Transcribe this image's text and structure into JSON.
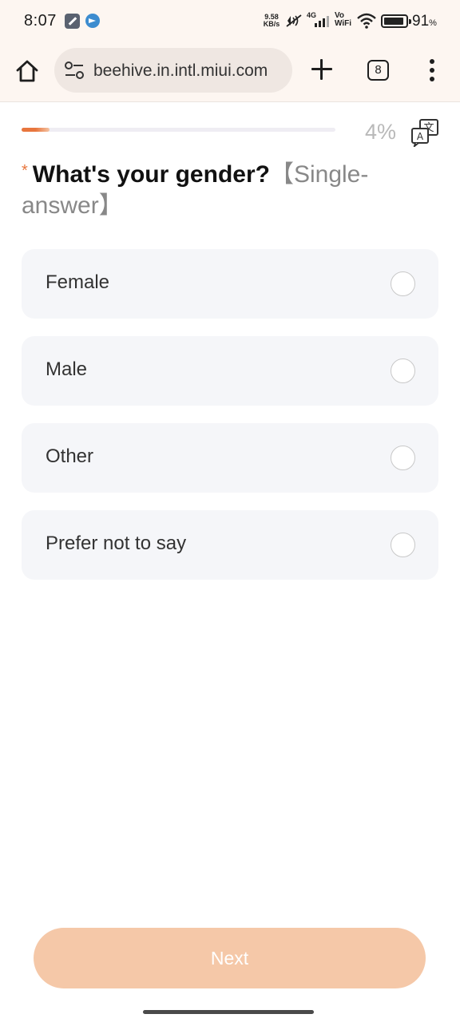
{
  "status_bar": {
    "time": "8:07",
    "net_speed_value": "9.58",
    "net_speed_unit": "KB/s",
    "signal_label": "4G",
    "vowifi_top": "Vo",
    "vowifi_bottom": "WiFi",
    "battery_percent": "91",
    "battery_percent_sign": "%",
    "battery_level": 0.91,
    "icons": [
      "wrench-icon",
      "telegram-icon",
      "mute-icon",
      "signal-icon",
      "wifi-icon",
      "battery-icon"
    ]
  },
  "browser": {
    "url": "beehive.in.intl.miui.com",
    "tab_count": "8",
    "icons": [
      "home-icon",
      "site-settings-icon",
      "new-tab-icon",
      "tab-switcher-icon",
      "menu-icon"
    ]
  },
  "survey": {
    "progress_label": "4%",
    "progress_value": 0.09,
    "required_mark": "*",
    "question": "What's your gender?",
    "question_type": "【Single-answer】",
    "options": [
      {
        "label": "Female"
      },
      {
        "label": "Male"
      },
      {
        "label": "Other"
      },
      {
        "label": "Prefer not to say"
      }
    ],
    "next_label": "Next"
  },
  "colors": {
    "accent": "#e8763d",
    "button": "#f5c8a8",
    "option_bg": "#f5f6f9",
    "chrome_bg": "#fdf6f1"
  }
}
